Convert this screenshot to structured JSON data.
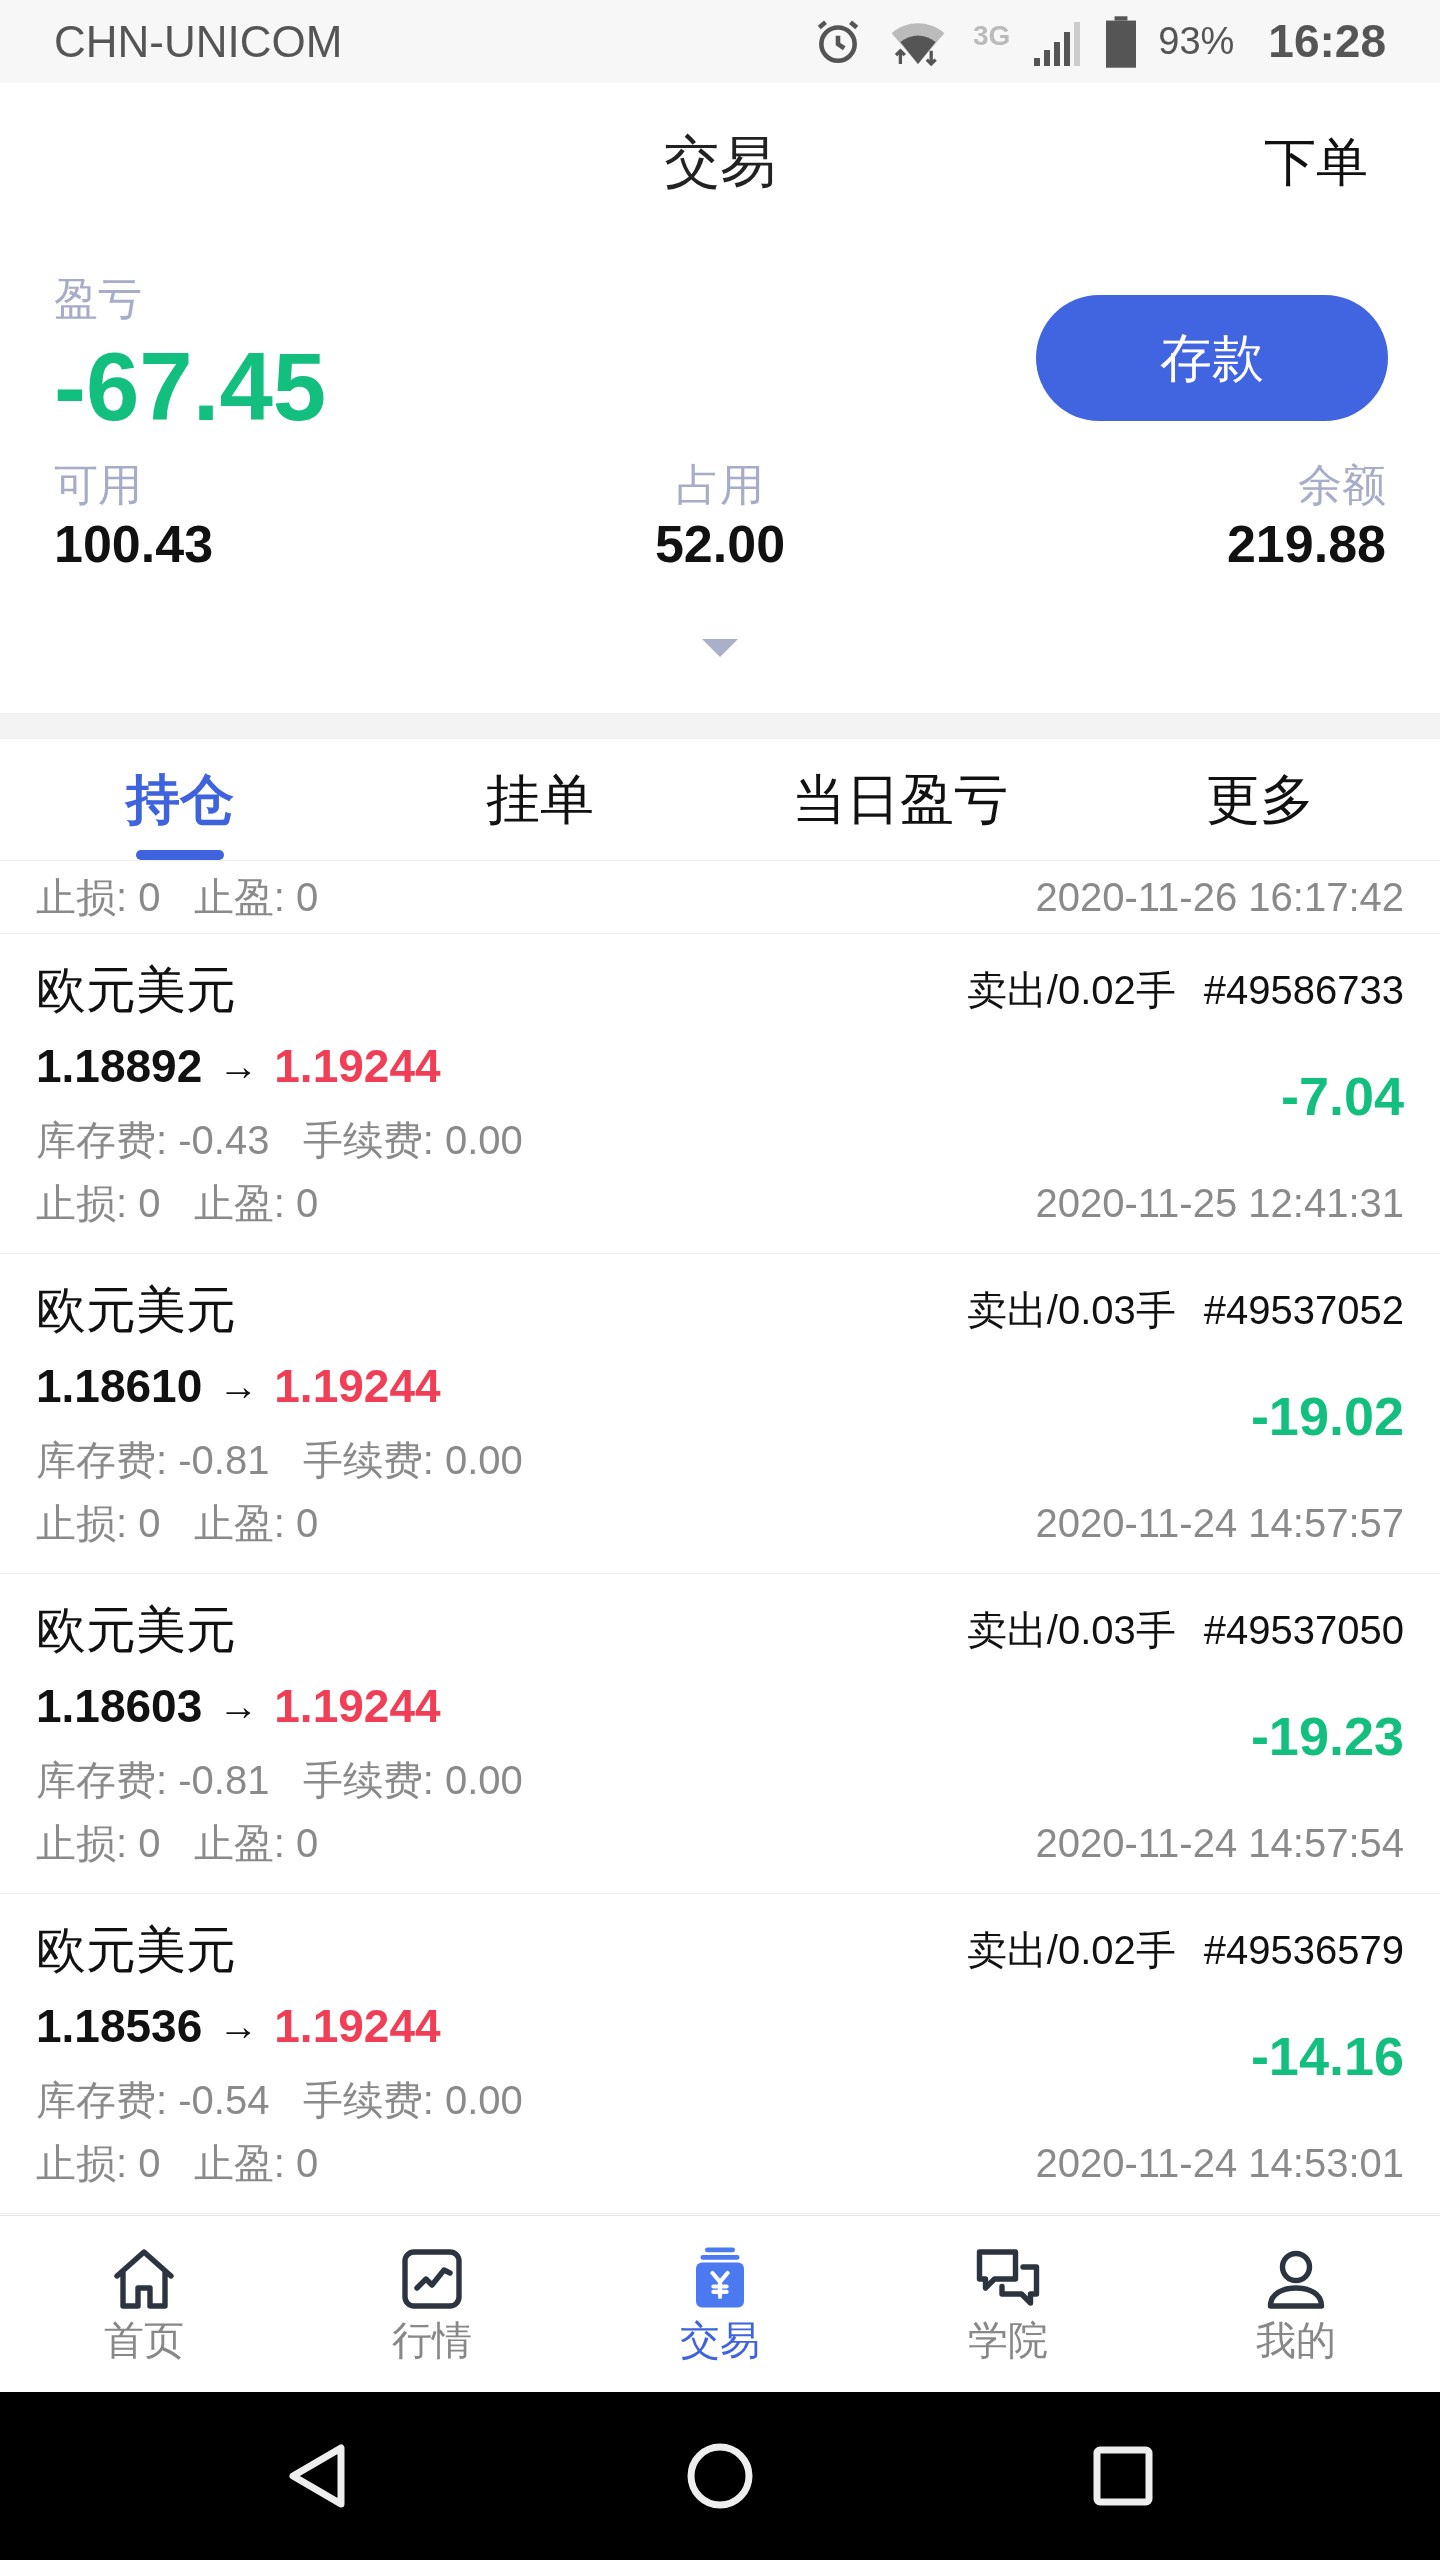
{
  "status_bar": {
    "carrier": "CHN-UNICOM",
    "network": "3G",
    "battery": "93%",
    "time": "16:28"
  },
  "header": {
    "title": "交易",
    "action": "下单"
  },
  "summary": {
    "pnl_label": "盈亏",
    "pnl": "-67.45",
    "button": "存款",
    "stats": [
      {
        "label": "可用",
        "value": "100.43"
      },
      {
        "label": "占用",
        "value": "52.00"
      },
      {
        "label": "余额",
        "value": "219.88"
      }
    ]
  },
  "tabs": [
    {
      "label": "持仓",
      "selected": true
    },
    {
      "label": "挂单",
      "selected": false
    },
    {
      "label": "当日盈亏",
      "selected": false
    },
    {
      "label": "更多",
      "selected": false
    }
  ],
  "partial_row": {
    "stops": "止损: 0   止盈: 0",
    "time": "2020-11-26 16:17:42"
  },
  "positions": [
    {
      "symbol": "欧元美元",
      "side": "卖出/0.02手",
      "ticket": "#49586733",
      "open": "1.18892",
      "arrow": "→",
      "current": "1.19244",
      "fees": "库存费: -0.43   手续费: 0.00",
      "stops": "止损: 0   止盈: 0",
      "pnl": "-7.04",
      "time": "2020-11-25 12:41:31"
    },
    {
      "symbol": "欧元美元",
      "side": "卖出/0.03手",
      "ticket": "#49537052",
      "open": "1.18610",
      "arrow": "→",
      "current": "1.19244",
      "fees": "库存费: -0.81   手续费: 0.00",
      "stops": "止损: 0   止盈: 0",
      "pnl": "-19.02",
      "time": "2020-11-24 14:57:57"
    },
    {
      "symbol": "欧元美元",
      "side": "卖出/0.03手",
      "ticket": "#49537050",
      "open": "1.18603",
      "arrow": "→",
      "current": "1.19244",
      "fees": "库存费: -0.81   手续费: 0.00",
      "stops": "止损: 0   止盈: 0",
      "pnl": "-19.23",
      "time": "2020-11-24 14:57:54"
    },
    {
      "symbol": "欧元美元",
      "side": "卖出/0.02手",
      "ticket": "#49536579",
      "open": "1.18536",
      "arrow": "→",
      "current": "1.19244",
      "fees": "库存费: -0.54   手续费: 0.00",
      "stops": "止损: 0   止盈: 0",
      "pnl": "-14.16",
      "time": "2020-11-24 14:53:01"
    }
  ],
  "bottom_nav": [
    {
      "kind": "home",
      "label": "首页",
      "selected": false
    },
    {
      "kind": "chart",
      "label": "行情",
      "selected": false
    },
    {
      "kind": "trade",
      "label": "交易",
      "selected": true
    },
    {
      "kind": "chat",
      "label": "学院",
      "selected": false
    },
    {
      "kind": "user",
      "label": "我的",
      "selected": false
    }
  ]
}
